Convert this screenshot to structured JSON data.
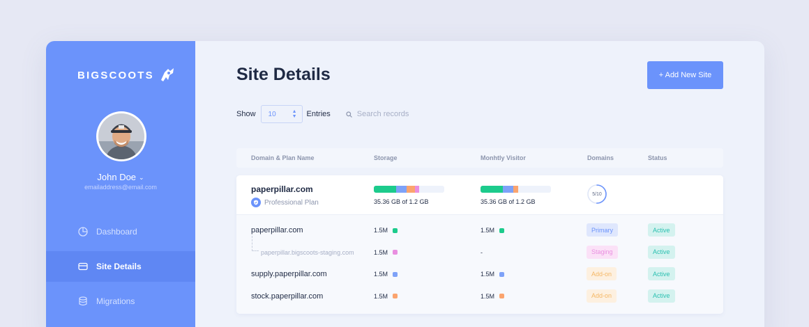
{
  "brand": {
    "name": "BIGSCOOTS",
    "logo_icon": "scoot-rocket-icon"
  },
  "user": {
    "name": "John Doe",
    "email": "emailaddress@email.com"
  },
  "nav": [
    {
      "label": "Dashboard",
      "icon": "pie-chart-icon",
      "active": false
    },
    {
      "label": "Site Details",
      "icon": "card-icon",
      "active": true
    },
    {
      "label": "Migrations",
      "icon": "database-icon",
      "active": false
    }
  ],
  "page": {
    "title": "Site Details",
    "add_button": "+ Add New Site"
  },
  "controls": {
    "show_label": "Show",
    "entries_value": "10",
    "entries_label": "Entries",
    "search_placeholder": "Search records"
  },
  "table": {
    "columns": [
      "Domain & Plan Name",
      "Storage",
      "Monhtly Visitor",
      "Domains",
      "Status"
    ],
    "group": {
      "site": "paperpillar.com",
      "plan": "Professional Plan",
      "storage_label": "35.36 GB of 1.2 GB",
      "visitor_label": "35.36 GB of 1.2 GB",
      "domains_used": "5/10",
      "domains_fraction": 0.5,
      "storage_segments": [
        {
          "fraction": 0.32,
          "color": "#1ccb8c"
        },
        {
          "fraction": 0.15,
          "color": "#7ea2f8"
        },
        {
          "fraction": 0.11,
          "color": "#fba46e"
        },
        {
          "fraction": 0.06,
          "color": "#e98fe0"
        }
      ],
      "visitor_segments": [
        {
          "fraction": 0.32,
          "color": "#1ccb8c"
        },
        {
          "fraction": 0.15,
          "color": "#7ea2f8"
        },
        {
          "fraction": 0.06,
          "color": "#fba46e"
        }
      ],
      "rows": [
        {
          "domain": "paperpillar.com",
          "storage": "1.5M",
          "storage_color": "#1ccb8c",
          "visitors": "1.5M",
          "visitors_color": "#1ccb8c",
          "type": "Primary",
          "type_bg": "#dfe7fd",
          "type_fg": "#6b93fb",
          "status": "Active",
          "staging": false
        },
        {
          "domain": "paperpillar.bigscoots-staging.com",
          "storage": "1.5M",
          "storage_color": "#e98fe0",
          "visitors": "-",
          "visitors_color": "",
          "type": "Staging",
          "type_bg": "#fbe1f7",
          "type_fg": "#e98fe0",
          "status": "Active",
          "staging": true
        },
        {
          "domain": "supply.paperpillar.com",
          "storage": "1.5M",
          "storage_color": "#7ea2f8",
          "visitors": "1.5M",
          "visitors_color": "#7ea2f8",
          "type": "Add-on",
          "type_bg": "#fdf0e0",
          "type_fg": "#f4b866",
          "status": "Active",
          "staging": false
        },
        {
          "domain": "stock.paperpillar.com",
          "storage": "1.5M",
          "storage_color": "#fba46e",
          "visitors": "1.5M",
          "visitors_color": "#fba46e",
          "type": "Add-on",
          "type_bg": "#fdf0e0",
          "type_fg": "#f4b866",
          "status": "Active",
          "staging": false
        }
      ]
    }
  }
}
